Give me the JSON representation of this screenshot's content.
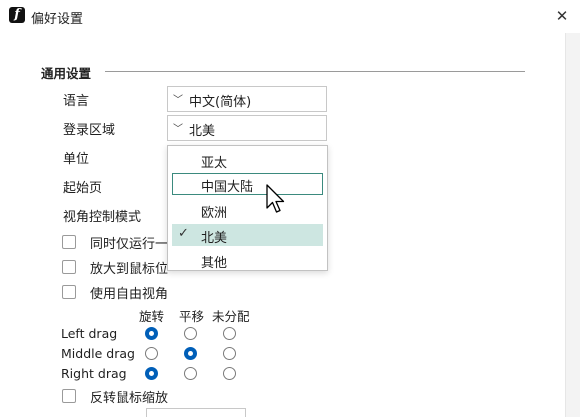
{
  "window": {
    "title": "偏好设置",
    "close_glyph": "✕",
    "app_icon_glyph": "f"
  },
  "section": {
    "title": "通用设置"
  },
  "labels": {
    "language": "语言",
    "region": "登录区域",
    "unit": "单位",
    "start_page": "起始页",
    "view_control": "视角控制模式"
  },
  "language_combo": {
    "value": "中文(简体)",
    "chevron": "﹀"
  },
  "region_combo": {
    "value": "北美",
    "chevron": "﹀"
  },
  "checkboxes": {
    "single_instance": "同时仅运行一",
    "zoom_to_cursor": "放大到鼠标位",
    "free_view": "使用自由视角",
    "reverse_zoom": "反转鼠标缩放"
  },
  "mouse_table": {
    "columns": [
      "旋转",
      "平移",
      "未分配"
    ],
    "rows": [
      {
        "label": "Left drag",
        "selected": 0
      },
      {
        "label": "Middle drag",
        "selected": 1
      },
      {
        "label": "Right drag",
        "selected": 0
      }
    ]
  },
  "region_dropdown": {
    "items": [
      "亚太",
      "中国大陆",
      "欧洲",
      "北美",
      "其他"
    ],
    "hovered": "中国大陆",
    "selected": "北美",
    "check_glyph": "✓"
  },
  "colors": {
    "accent": "#005fb8",
    "selected_bg": "#cde6e1",
    "hover_border": "#3b8a7e"
  }
}
